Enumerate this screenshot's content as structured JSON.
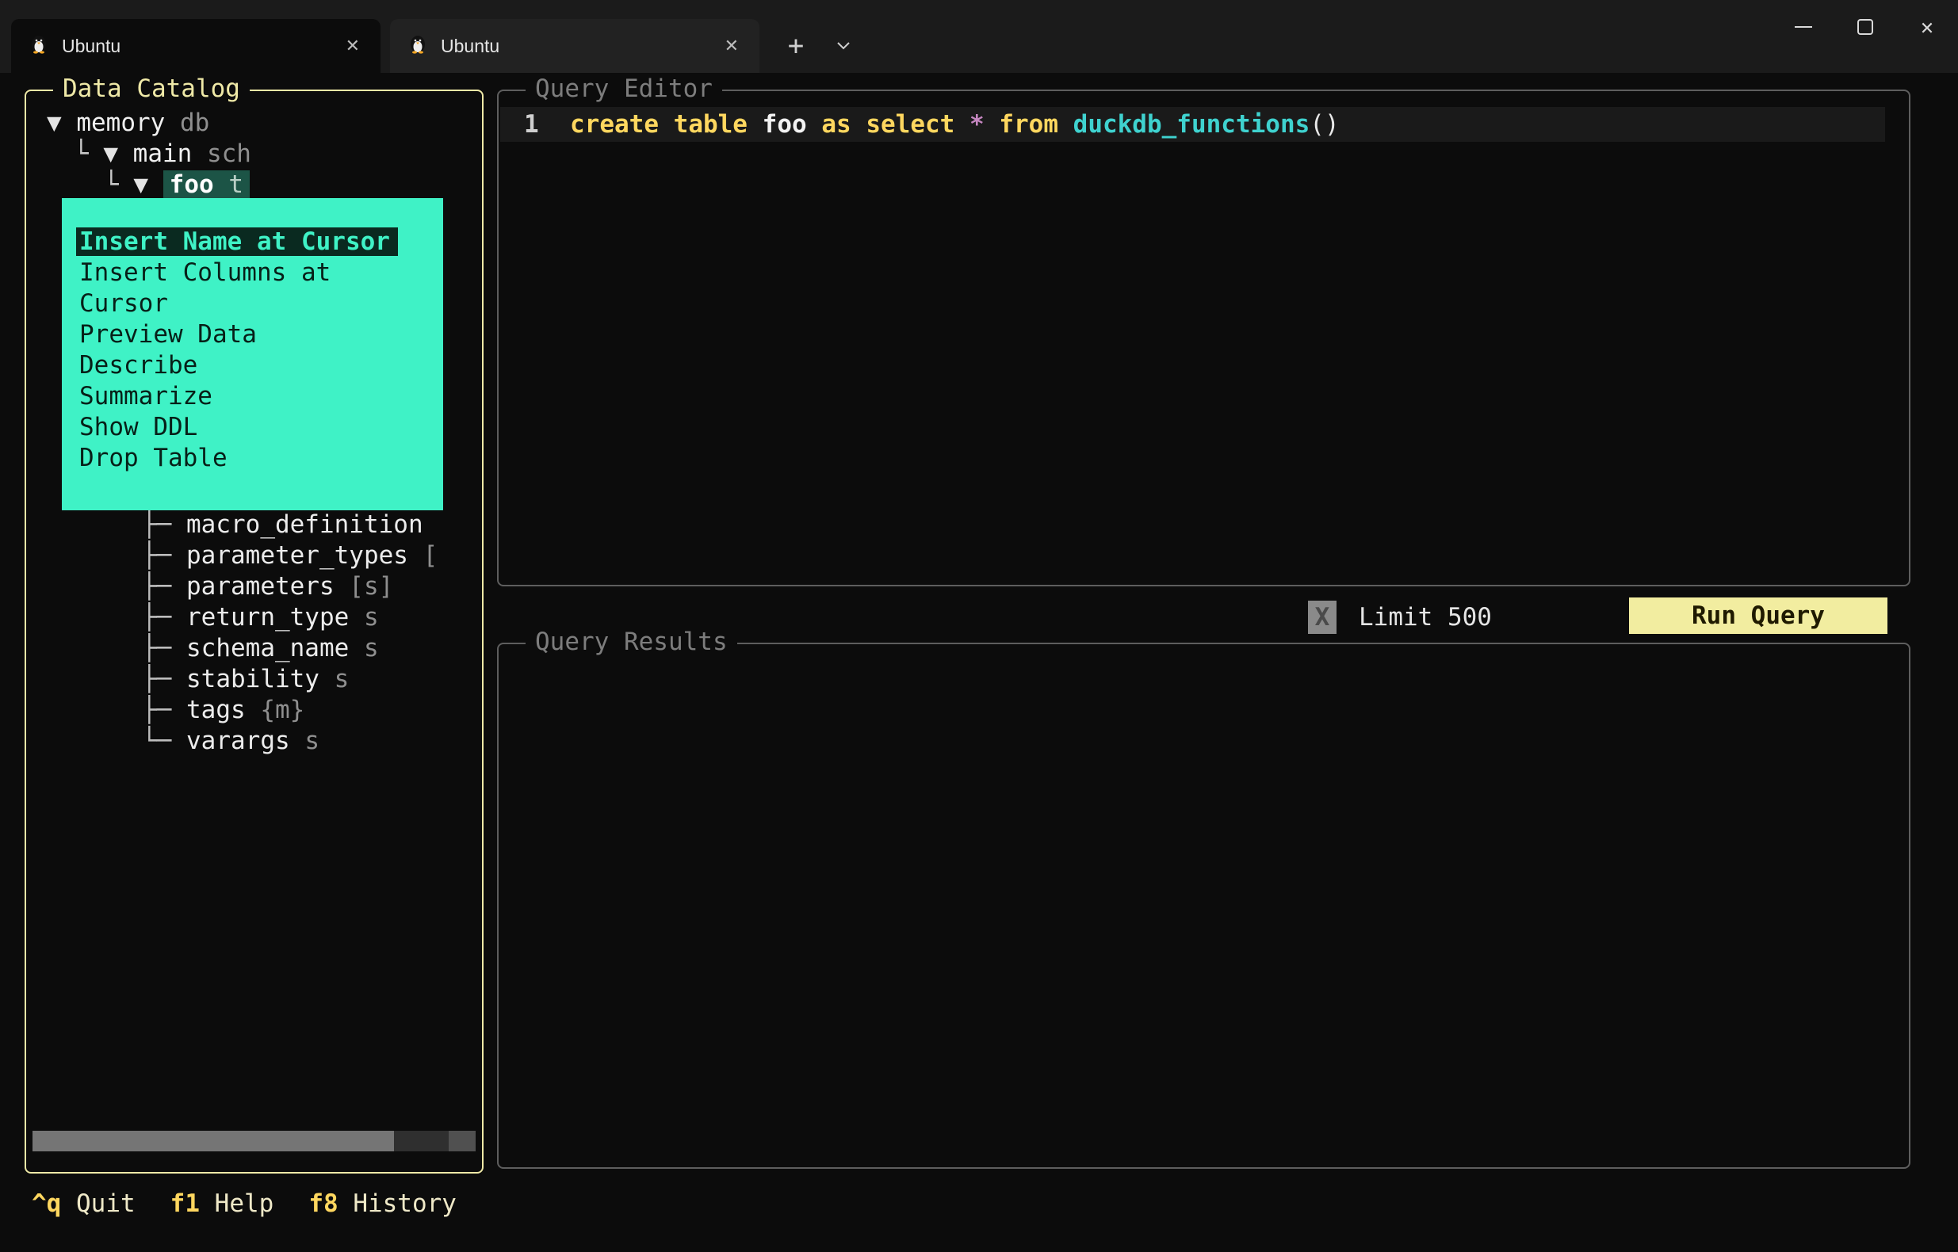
{
  "colors": {
    "terminal_bg": "#0c0c0c",
    "accent_yellow": "#efe9a7",
    "menu_teal": "#3ff2c6",
    "keyword_gold": "#ffd75f",
    "function_cyan": "#3fd2cf",
    "star_purple": "#c586c0",
    "run_button_bg": "#f2eda0",
    "selected_node_bg": "#1c5446"
  },
  "window": {
    "tabs": [
      {
        "label": "Ubuntu"
      },
      {
        "label": "Ubuntu"
      }
    ],
    "close_glyph": "✕"
  },
  "catalog": {
    "title": "Data Catalog",
    "tree": [
      {
        "depth": 0,
        "connector": "",
        "arrow": "▼",
        "label": "memory",
        "type": "db",
        "selected": false
      },
      {
        "depth": 1,
        "connector": "└",
        "arrow": "▼",
        "label": "main",
        "type": "sch",
        "selected": false
      },
      {
        "depth": 2,
        "connector": "└",
        "arrow": "▼",
        "label": "foo",
        "type": "t",
        "selected": true
      }
    ],
    "columns": [
      {
        "prefix": "├─",
        "name": "macro_definition",
        "type": ""
      },
      {
        "prefix": "├─",
        "name": "parameter_types",
        "type": "["
      },
      {
        "prefix": "├─",
        "name": "parameters",
        "type": "[s]"
      },
      {
        "prefix": "├─",
        "name": "return_type",
        "type": "s"
      },
      {
        "prefix": "├─",
        "name": "schema_name",
        "type": "s"
      },
      {
        "prefix": "├─",
        "name": "stability",
        "type": "s"
      },
      {
        "prefix": "├─",
        "name": "tags",
        "type": "{m}"
      },
      {
        "prefix": "└─",
        "name": "varargs",
        "type": "s"
      }
    ]
  },
  "context_menu": {
    "items": [
      {
        "label": "Insert Name at Cursor",
        "selected": true
      },
      {
        "label": "Insert Columns at Cursor",
        "selected": false
      },
      {
        "label": "Preview Data",
        "selected": false
      },
      {
        "label": "Describe",
        "selected": false
      },
      {
        "label": "Summarize",
        "selected": false
      },
      {
        "label": "Show DDL",
        "selected": false
      },
      {
        "label": "Drop Table",
        "selected": false
      }
    ]
  },
  "editor": {
    "title": "Query Editor",
    "line_number": "1",
    "tokens": [
      {
        "text": "create",
        "cls": "kw"
      },
      {
        "text": " ",
        "cls": "plain"
      },
      {
        "text": "table",
        "cls": "kw"
      },
      {
        "text": " ",
        "cls": "plain"
      },
      {
        "text": "foo",
        "cls": "ident"
      },
      {
        "text": " ",
        "cls": "plain"
      },
      {
        "text": "as",
        "cls": "kw"
      },
      {
        "text": " ",
        "cls": "plain"
      },
      {
        "text": "select",
        "cls": "kw"
      },
      {
        "text": " ",
        "cls": "plain"
      },
      {
        "text": "*",
        "cls": "star"
      },
      {
        "text": " ",
        "cls": "plain"
      },
      {
        "text": "from",
        "cls": "kw"
      },
      {
        "text": " ",
        "cls": "plain"
      },
      {
        "text": "duckdb_functions",
        "cls": "fn"
      },
      {
        "text": "()",
        "cls": "paren"
      }
    ]
  },
  "run_bar": {
    "checkbox": "X",
    "limit_label": "Limit 500",
    "run_label": "Run Query"
  },
  "results": {
    "title": "Query Results"
  },
  "footer": {
    "entries": [
      {
        "key": "^q",
        "label": "Quit"
      },
      {
        "key": "f1",
        "label": "Help"
      },
      {
        "key": "f8",
        "label": "History"
      }
    ]
  }
}
